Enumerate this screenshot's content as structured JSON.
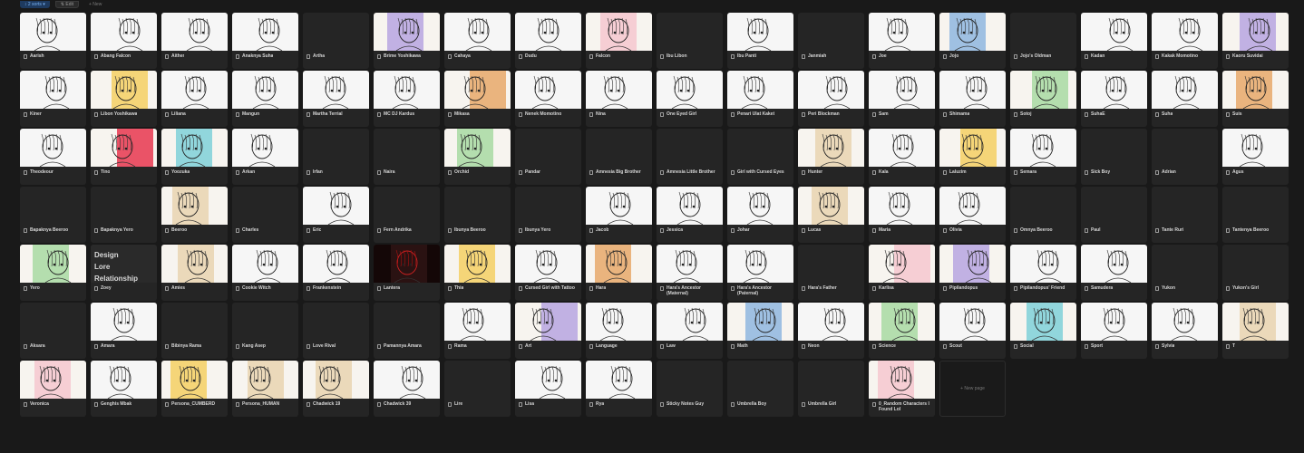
{
  "toolbar": {
    "sort_label": "↕ 2 sorts ▾",
    "filter_label": "⇅ Edit",
    "new_label": "+ New"
  },
  "new_page_label": "+ New page",
  "text_card_lines": [
    "Design",
    "Lore",
    "Relationship"
  ],
  "cards": [
    {
      "name": "Aarish",
      "thumb": "sketch"
    },
    {
      "name": "Abang Falcon",
      "thumb": "sketch"
    },
    {
      "name": "Aither",
      "thumb": "sketch"
    },
    {
      "name": "Anaknya Suha",
      "thumb": "sketch"
    },
    {
      "name": "Artha",
      "thumb": "none"
    },
    {
      "name": "Brime Yoshikawa",
      "thumb": "purple"
    },
    {
      "name": "Cahaya",
      "thumb": "sketch"
    },
    {
      "name": "Dudu",
      "thumb": "sketch"
    },
    {
      "name": "Falcon",
      "thumb": "pink"
    },
    {
      "name": "Ibu Libon",
      "thumb": "none"
    },
    {
      "name": "Ibu Panti",
      "thumb": "sketch"
    },
    {
      "name": "Janmiah",
      "thumb": "none"
    },
    {
      "name": "Joe",
      "thumb": "sketch"
    },
    {
      "name": "Jojo",
      "thumb": "blue"
    },
    {
      "name": "Jojo's Oldman",
      "thumb": "none"
    },
    {
      "name": "Kadan",
      "thumb": "sketch"
    },
    {
      "name": "Kakak Momotino",
      "thumb": "sketch"
    },
    {
      "name": "Kaoru Suvidai",
      "thumb": "purple"
    },
    {
      "name": "Kiner",
      "thumb": "sketch"
    },
    {
      "name": "Libon Yoshikawa",
      "thumb": "yellow"
    },
    {
      "name": "Liliana",
      "thumb": "sketch"
    },
    {
      "name": "Mangun",
      "thumb": "sketch"
    },
    {
      "name": "Martha Terrial",
      "thumb": "sketch"
    },
    {
      "name": "MC DJ Kardus",
      "thumb": "sketch"
    },
    {
      "name": "Mikasa",
      "thumb": "orange"
    },
    {
      "name": "Nenek Momotino",
      "thumb": "sketch"
    },
    {
      "name": "Nina",
      "thumb": "sketch"
    },
    {
      "name": "One Eyed Girl",
      "thumb": "sketch"
    },
    {
      "name": "Penari Ulat Kaket",
      "thumb": "sketch"
    },
    {
      "name": "Peri Blockman",
      "thumb": "sketch"
    },
    {
      "name": "Sam",
      "thumb": "sketch"
    },
    {
      "name": "Shimama",
      "thumb": "sketch"
    },
    {
      "name": "Sotoj",
      "thumb": "green"
    },
    {
      "name": "SuhaE",
      "thumb": "sketch"
    },
    {
      "name": "Suha",
      "thumb": "sketch"
    },
    {
      "name": "Suis",
      "thumb": "orange"
    },
    {
      "name": "Theodeour",
      "thumb": "sketch"
    },
    {
      "name": "Tino",
      "thumb": "red"
    },
    {
      "name": "Yoozuka",
      "thumb": "teal"
    },
    {
      "name": "Arkan",
      "thumb": "sketch"
    },
    {
      "name": "Irfan",
      "thumb": "none"
    },
    {
      "name": "Naira",
      "thumb": "none"
    },
    {
      "name": "Orchid",
      "thumb": "green"
    },
    {
      "name": "Pandar",
      "thumb": "none"
    },
    {
      "name": "Amnesia Big Brother",
      "thumb": "none"
    },
    {
      "name": "Amnesia Little Brother",
      "thumb": "none"
    },
    {
      "name": "Girl with Cursed Eyes",
      "thumb": "none"
    },
    {
      "name": "Hunter",
      "thumb": "tan"
    },
    {
      "name": "Kala",
      "thumb": "sketch"
    },
    {
      "name": "Laluzim",
      "thumb": "yellow"
    },
    {
      "name": "Semara",
      "thumb": "sketch"
    },
    {
      "name": "Sick Boy",
      "thumb": "none"
    },
    {
      "name": "Adrian",
      "thumb": "none"
    },
    {
      "name": "Agus",
      "thumb": "sketch"
    },
    {
      "name": "Bapaknya Beeroo",
      "thumb": "none"
    },
    {
      "name": "Bapaknya Yero",
      "thumb": "none"
    },
    {
      "name": "Beeroo",
      "thumb": "tan"
    },
    {
      "name": "Charles",
      "thumb": "none"
    },
    {
      "name": "Eric",
      "thumb": "sketch"
    },
    {
      "name": "Fern Andrika",
      "thumb": "none"
    },
    {
      "name": "Ibunya Beeroo",
      "thumb": "none"
    },
    {
      "name": "Ibunya Yero",
      "thumb": "none"
    },
    {
      "name": "Jacob",
      "thumb": "sketch"
    },
    {
      "name": "Jessica",
      "thumb": "sketch"
    },
    {
      "name": "Johar",
      "thumb": "sketch"
    },
    {
      "name": "Lucas",
      "thumb": "tan"
    },
    {
      "name": "Maria",
      "thumb": "sketch"
    },
    {
      "name": "Olivia",
      "thumb": "sketch"
    },
    {
      "name": "Omnya Beeroo",
      "thumb": "none"
    },
    {
      "name": "Paul",
      "thumb": "none"
    },
    {
      "name": "Tante Ruri",
      "thumb": "none"
    },
    {
      "name": "Tantenya Beeroo",
      "thumb": "none"
    },
    {
      "name": "Yero",
      "thumb": "green"
    },
    {
      "name": "Zoey",
      "thumb": "text"
    },
    {
      "name": "Amies",
      "thumb": "tan"
    },
    {
      "name": "Cookie Witch",
      "thumb": "sketch"
    },
    {
      "name": "Frankenstein",
      "thumb": "sketch"
    },
    {
      "name": "Lantera",
      "thumb": "dark"
    },
    {
      "name": "Thia",
      "thumb": "yellow"
    },
    {
      "name": "Cursed Girl with Tattoo",
      "thumb": "sketch"
    },
    {
      "name": "Hara",
      "thumb": "orange"
    },
    {
      "name": "Hara's Ancestor (Maternal)",
      "thumb": "sketch"
    },
    {
      "name": "Hara's Ancestor (Paternal)",
      "thumb": "sketch"
    },
    {
      "name": "Hara's Father",
      "thumb": "none"
    },
    {
      "name": "Karlisa",
      "thumb": "pink"
    },
    {
      "name": "Pipilandopus",
      "thumb": "purple"
    },
    {
      "name": "Pipilandopus' Friend",
      "thumb": "sketch"
    },
    {
      "name": "Samudera",
      "thumb": "sketch"
    },
    {
      "name": "Yukon",
      "thumb": "none"
    },
    {
      "name": "Yukon's Girl",
      "thumb": "none"
    },
    {
      "name": "Aksara",
      "thumb": "none"
    },
    {
      "name": "Amara",
      "thumb": "sketch"
    },
    {
      "name": "Bibinya Rama",
      "thumb": "none"
    },
    {
      "name": "Kang Asep",
      "thumb": "none"
    },
    {
      "name": "Love Rival",
      "thumb": "none"
    },
    {
      "name": "Pamannya Amara",
      "thumb": "none"
    },
    {
      "name": "Rama",
      "thumb": "sketch"
    },
    {
      "name": "Art",
      "thumb": "purple"
    },
    {
      "name": "Language",
      "thumb": "sketch"
    },
    {
      "name": "Law",
      "thumb": "sketch"
    },
    {
      "name": "Math",
      "thumb": "blue"
    },
    {
      "name": "Neon",
      "thumb": "sketch"
    },
    {
      "name": "Science",
      "thumb": "green"
    },
    {
      "name": "Scout",
      "thumb": "sketch"
    },
    {
      "name": "Social",
      "thumb": "teal"
    },
    {
      "name": "Sport",
      "thumb": "sketch"
    },
    {
      "name": "Sylvia",
      "thumb": "sketch"
    },
    {
      "name": "T",
      "thumb": "tan"
    },
    {
      "name": "Veronica",
      "thumb": "pink"
    },
    {
      "name": "Genghis Mbak",
      "thumb": "sketch"
    },
    {
      "name": "Persona_CUMBERD",
      "thumb": "yellow"
    },
    {
      "name": "Persona_HUMAN",
      "thumb": "tan"
    },
    {
      "name": "Chadwick 19",
      "thumb": "tan"
    },
    {
      "name": "Chadwick 39",
      "thumb": "sketch"
    },
    {
      "name": "Lire",
      "thumb": "none"
    },
    {
      "name": "Lisa",
      "thumb": "sketch"
    },
    {
      "name": "Rya",
      "thumb": "sketch"
    },
    {
      "name": "Sticky Notes Guy",
      "thumb": "none"
    },
    {
      "name": "Umbrella Boy",
      "thumb": "none"
    },
    {
      "name": "Umbrella Girl",
      "thumb": "none"
    },
    {
      "name": "0_Random Characters I Found Lol",
      "thumb": "pink"
    }
  ],
  "thumb_colors": {
    "sketch": "#f4f4f4",
    "purple": "#b7a5e0",
    "pink": "#f6c7cf",
    "blue": "#8fb6df",
    "yellow": "#f4cf63",
    "orange": "#e8a86a",
    "green": "#a8d9a2",
    "red": "#e8364f",
    "teal": "#7fd0d8",
    "tan": "#e9d3b0",
    "dark": "#2a1212"
  }
}
